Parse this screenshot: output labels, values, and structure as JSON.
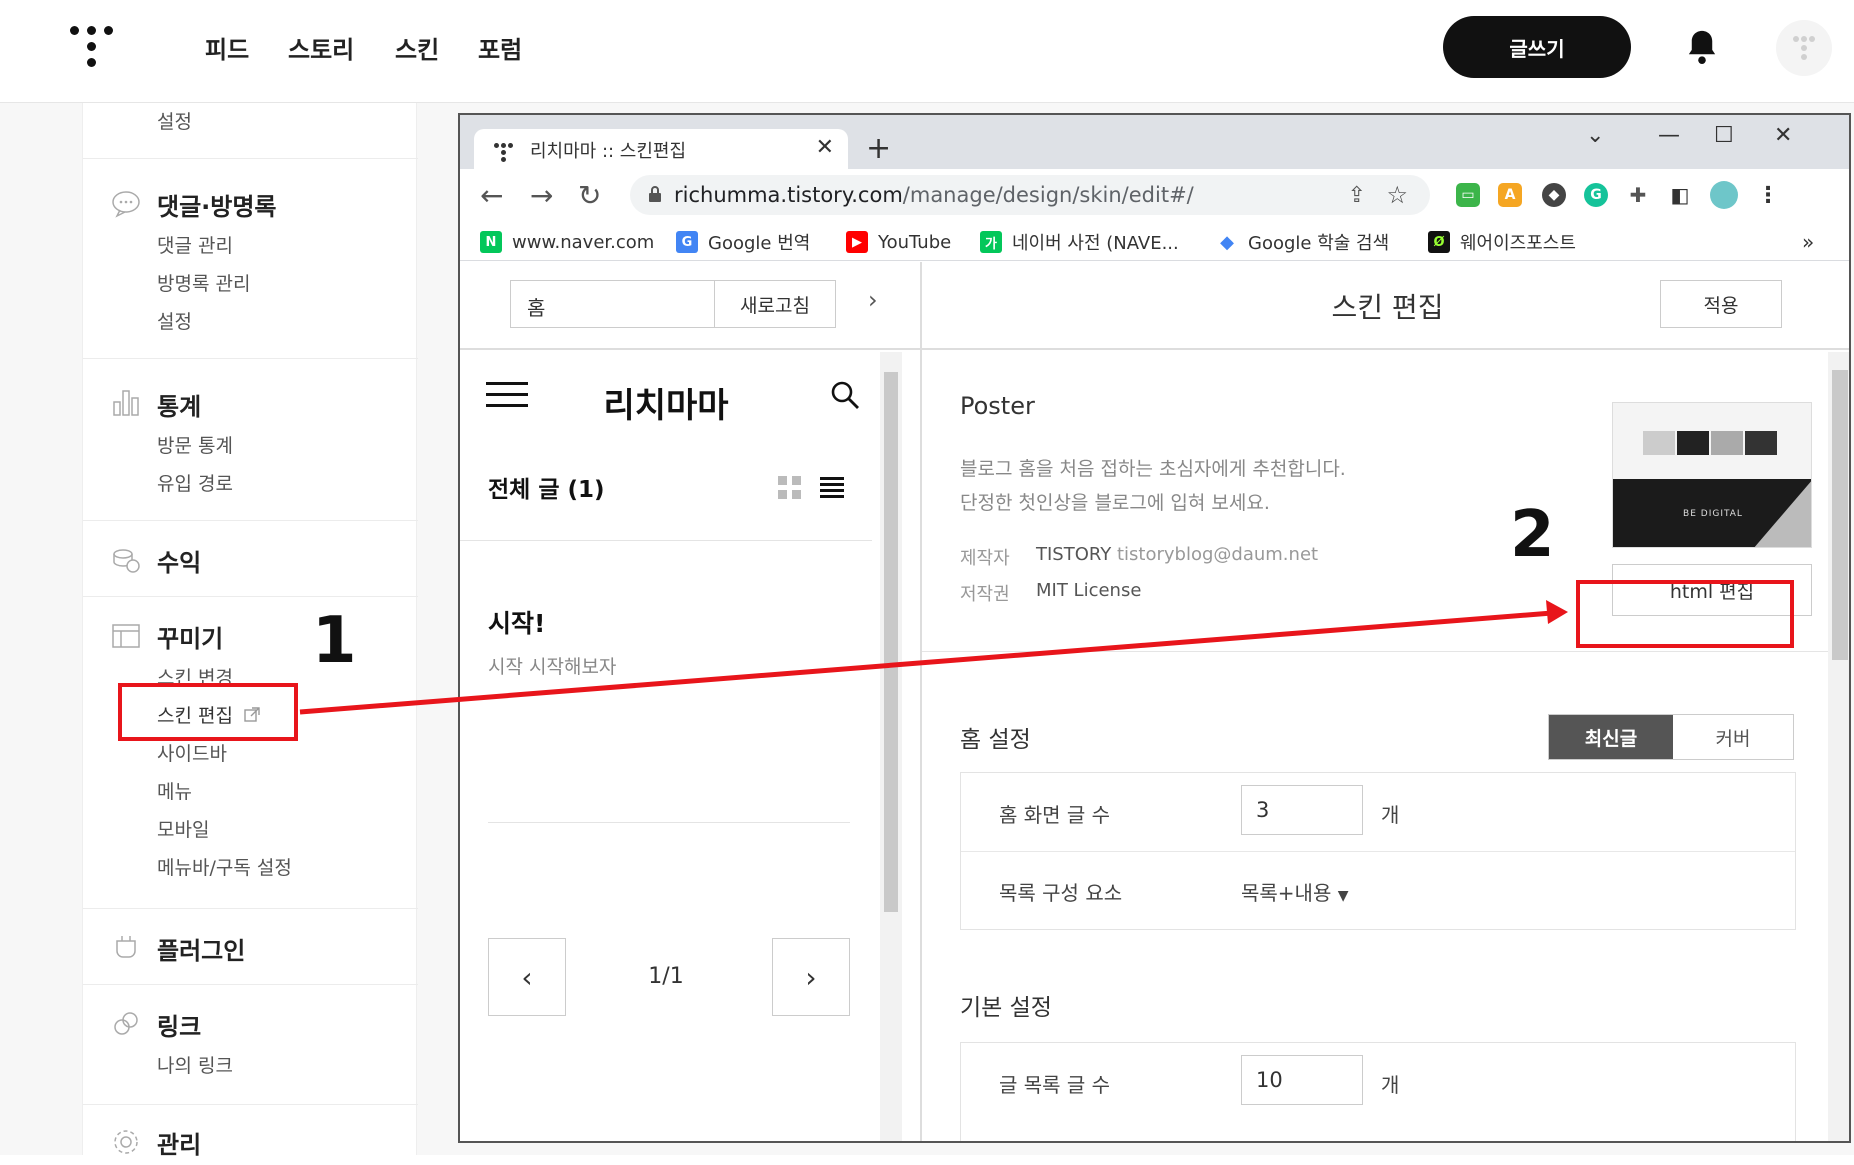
{
  "topnav": {
    "links": [
      "피드",
      "스토리",
      "스킨",
      "포럼"
    ],
    "write_label": "글쓰기"
  },
  "sidebar": {
    "top_item": "설정",
    "sections": [
      {
        "title": "댓글·방명록",
        "items": [
          "댓글 관리",
          "방명록 관리",
          "설정"
        ]
      },
      {
        "title": "통계",
        "items": [
          "방문 통계",
          "유입 경로"
        ]
      },
      {
        "title": "수익",
        "items": []
      },
      {
        "title": "꾸미기",
        "items": [
          "스킨 변경",
          "스킨 편집",
          "사이드바",
          "메뉴",
          "모바일",
          "메뉴바/구독 설정"
        ]
      },
      {
        "title": "플러그인",
        "items": []
      },
      {
        "title": "링크",
        "items": [
          "나의 링크"
        ]
      },
      {
        "title": "관리",
        "items": []
      }
    ]
  },
  "browser": {
    "tab_title": "리치마마 :: 스킨편집",
    "url_host": "richumma.tistory.com",
    "url_path": "/manage/design/skin/edit#/",
    "bookmarks": [
      "www.naver.com",
      "Google 번역",
      "YouTube",
      "네이버 사전 (NAVE...",
      "Google 학술 검색",
      "웨어이즈포스트"
    ]
  },
  "preview": {
    "page_input": "홈",
    "refresh_label": "새로고침",
    "blog_title": "리치마마",
    "list_title": "전체 글 (1)",
    "post_title": "시작!",
    "post_excerpt": "시작 시작해보자",
    "pagination": "1/1"
  },
  "editor": {
    "title": "스킨 편집",
    "apply_label": "적용",
    "skin_name": "Poster",
    "desc_line1": "블로그 홈을 처음 접하는 초심자에게 추천합니다.",
    "desc_line2": "단정한 첫인상을 블로그에 입혀 보세요.",
    "maker_key": "제작자",
    "maker_name": "TISTORY",
    "maker_email": "tistoryblog@daum.net",
    "license_key": "저작권",
    "license_val": "MIT License",
    "thumb_caption": "BE DIGITAL",
    "html_edit_label": "html 편집",
    "home_settings": {
      "title": "홈 설정",
      "toggle": [
        "최신글",
        "커버"
      ],
      "home_count_label": "홈 화면 글 수",
      "home_count": "3",
      "unit": "개",
      "list_elements_label": "목록 구성 요소",
      "list_elements_value": "목록+내용"
    },
    "basic_settings": {
      "title": "기본 설정",
      "list_count_label": "글 목록 글 수",
      "list_count": "10",
      "unit": "개"
    }
  },
  "annotations": [
    "1",
    "2"
  ],
  "colors": {
    "annotation_red": "#e8151b",
    "toggle_active": "#555555",
    "write_button": "#111111"
  }
}
